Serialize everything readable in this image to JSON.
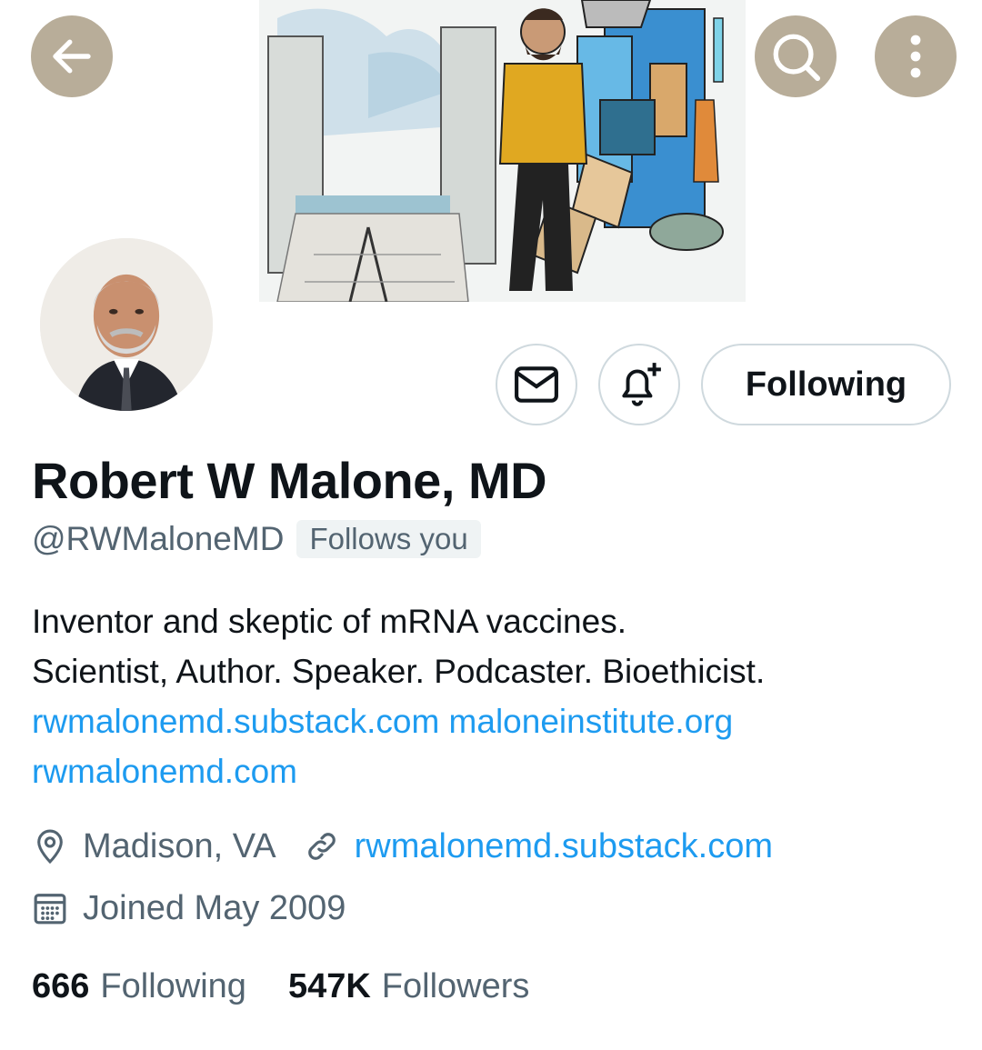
{
  "profile": {
    "name": "Robert W Malone, MD",
    "handle": "@RWMaloneMD",
    "follows_you": "Follows you",
    "bio_line1": "Inventor and skeptic of mRNA vaccines.",
    "bio_line2": "Scientist, Author. Speaker. Podcaster. Bioethicist.",
    "bio_link1": "rwmalonemd.substack.com",
    "bio_link2": "maloneinstitute.org",
    "bio_link3": "rwmalonemd.com",
    "location": "Madison, VA",
    "website": "rwmalonemd.substack.com",
    "joined": "Joined May 2009"
  },
  "actions": {
    "follow_label": "Following"
  },
  "stats": {
    "following_count": "666",
    "following_label": "Following",
    "followers_count": "547K",
    "followers_label": "Followers"
  },
  "colors": {
    "link": "#1d9bf0",
    "secondary_text": "#536471",
    "header_button": "#b8ad99"
  },
  "icons": [
    "back-arrow-icon",
    "search-icon",
    "more-vertical-icon",
    "mail-icon",
    "bell-plus-icon",
    "location-pin-icon",
    "link-icon",
    "calendar-icon"
  ]
}
